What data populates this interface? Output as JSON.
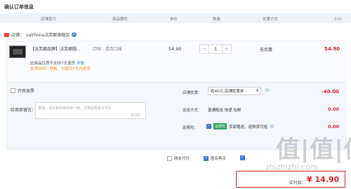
{
  "page_title": "确认订单信息",
  "table_header": {
    "shop": "店铺宝贝",
    "attr": "商品属性",
    "price": "单价",
    "qty": "数量",
    "discount": "优惠方式",
    "subtotal": "小计"
  },
  "shop": {
    "label": "店铺：",
    "name": "valrhona法芙娜旗舰店"
  },
  "item": {
    "name": "【法芙娜品牌】法芙娜圆...",
    "spec": "口味：混合口味",
    "no_return_note": "此商品性质不支持7天退货",
    "no_return_link": "详情",
    "shipping_note": "发货时间：预售，付款后7天内发货",
    "price": "54.90",
    "qty": "1",
    "minus": "−",
    "plus": "+",
    "discount": "无优惠",
    "subtotal": "54.90"
  },
  "invoice": {
    "label": "开具发票"
  },
  "shop_promo": {
    "label": "店铺优惠：",
    "selected": "省40元:店铺优惠券",
    "value": "-40.00"
  },
  "message": {
    "label": "给卖家留言：",
    "placeholder": "选填，请先和商家协商一致，付款后再留言可见",
    "count": "0/200"
  },
  "shipping": {
    "label": "运送方式：",
    "value": "普通配送 快递 包邮",
    "price": "0.00"
  },
  "insurance": {
    "label": "运费险：",
    "badge": "运费险",
    "text": "卖家赠送，退换货可赔",
    "price": "0.00"
  },
  "options": {
    "proxy_pay": "朋友代付",
    "anonymous": "匿名购买"
  },
  "total": {
    "label": "实付款：",
    "currency": "¥",
    "value": "14.90"
  },
  "watermark": {
    "brand": "值|值|值",
    "site": "zhizhizhi.com"
  }
}
